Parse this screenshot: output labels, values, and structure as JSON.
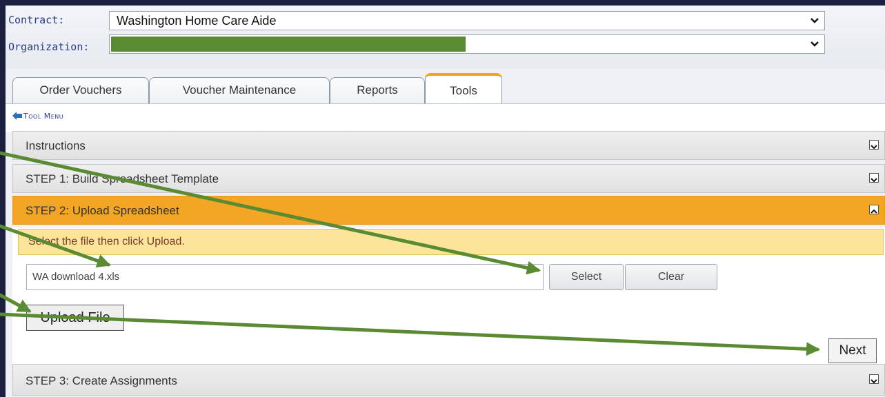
{
  "header": {
    "contract_label": "Contract:",
    "contract_value": "Washington Home Care Aide",
    "organization_label": "Organization:",
    "organization_value": ""
  },
  "tabs": [
    {
      "label": "Order Vouchers"
    },
    {
      "label": "Voucher Maintenance"
    },
    {
      "label": "Reports"
    },
    {
      "label": "Tools",
      "active": true
    }
  ],
  "tool_menu": {
    "label": "Tool Menu",
    "icon": "back-arrow-icon"
  },
  "panels": {
    "instructions": "Instructions",
    "step1": "STEP 1: Build Spreadsheet Template",
    "step2": "STEP 2: Upload Spreadsheet",
    "step3": "STEP 3: Create Assignments"
  },
  "step2": {
    "hint": "Select the file then click Upload.",
    "file_value": "WA download 4.xls",
    "select_label": "Select",
    "clear_label": "Clear",
    "upload_label": "Upload File",
    "next_label": "Next"
  },
  "colors": {
    "accent": "#f2a624",
    "redaction": "#5a8a32",
    "annotation_arrow": "#5a8a32",
    "background": "#1a1f3f"
  }
}
